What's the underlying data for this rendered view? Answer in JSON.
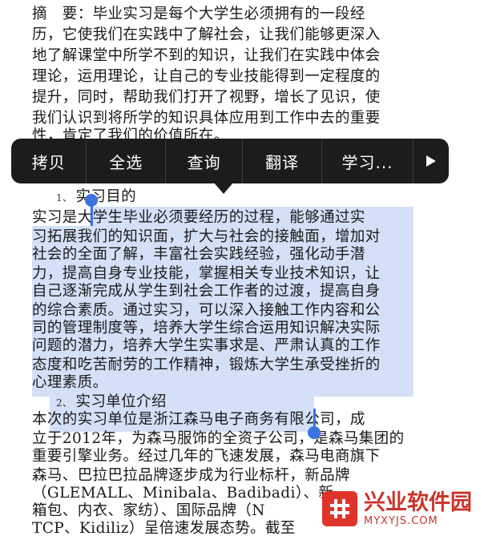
{
  "document": {
    "abstract_lines": [
      "    摘　要：毕业实习是每个大学生必须拥有的一段经",
      "历，它使我们在实践中了解社会，让我们能够更深入",
      "地了解课堂中所学不到的知识，让我们在实践中体会",
      "理论，运用理论，让自己的专业技能得到一定程度的",
      "提升，同时，帮助我们打开了视野，增长了见识，使",
      "我们认识到将所学的知识具体应用到工作中去的重要",
      "性，肯定了我们的价值所在。"
    ],
    "section1": {
      "num": "1、",
      "title": "实习目的",
      "lines": [
        "    实习是大学生毕业必须要经历的过程，能够通过实",
        "习拓展我们的知识面，扩大与社会的接触面，增加对",
        "社会的全面了解，丰富社会实践经验，强化动手潜",
        "力，提高自身专业技能，掌握相关专业技术知识，让",
        "自己逐渐完成从学生到社会工作者的过渡，提高自身",
        "的综合素质。通过实习，可以深入接触工作内容和公",
        "司的管理制度等，培养大学生综合运用知识解决实际",
        "问题的潜力，培养大学生实事求是、严肃认真的工作",
        "态度和吃苦耐劳的工作精神，锻炼大学生承受挫折的",
        "心理素质。"
      ]
    },
    "section2": {
      "num": "2、",
      "title": "实习单位介绍",
      "lines": [
        "    本次的实习单位是浙江森马电子商务有限公司，成",
        "立于2012年，为森马服饰的全资子公司，是森马集团的",
        "重要引擎业务。经过几年的飞速发展，森马电商旗下",
        "森马、巴拉巴拉品牌逐步成为行业标杆，新品牌",
        "（GLEMALL、Minibala、Badibadi）、新",
        "箱包、内衣、家纺）、国际品牌（N",
        "TCP、Kidiliz）呈倍速发展态势。截至"
      ]
    }
  },
  "context_menu": {
    "items": [
      "拷贝",
      "全选",
      "查询",
      "翻译",
      "学习..."
    ],
    "more_icon": "play-triangle-icon"
  },
  "watermark": {
    "title": "兴业软件园",
    "url": "MYXYJS.COM"
  },
  "colors": {
    "selection": "#78a0e6",
    "handle": "#3b74e0",
    "menu_bg": "#1c1c1c",
    "watermark": "#c9342b"
  }
}
